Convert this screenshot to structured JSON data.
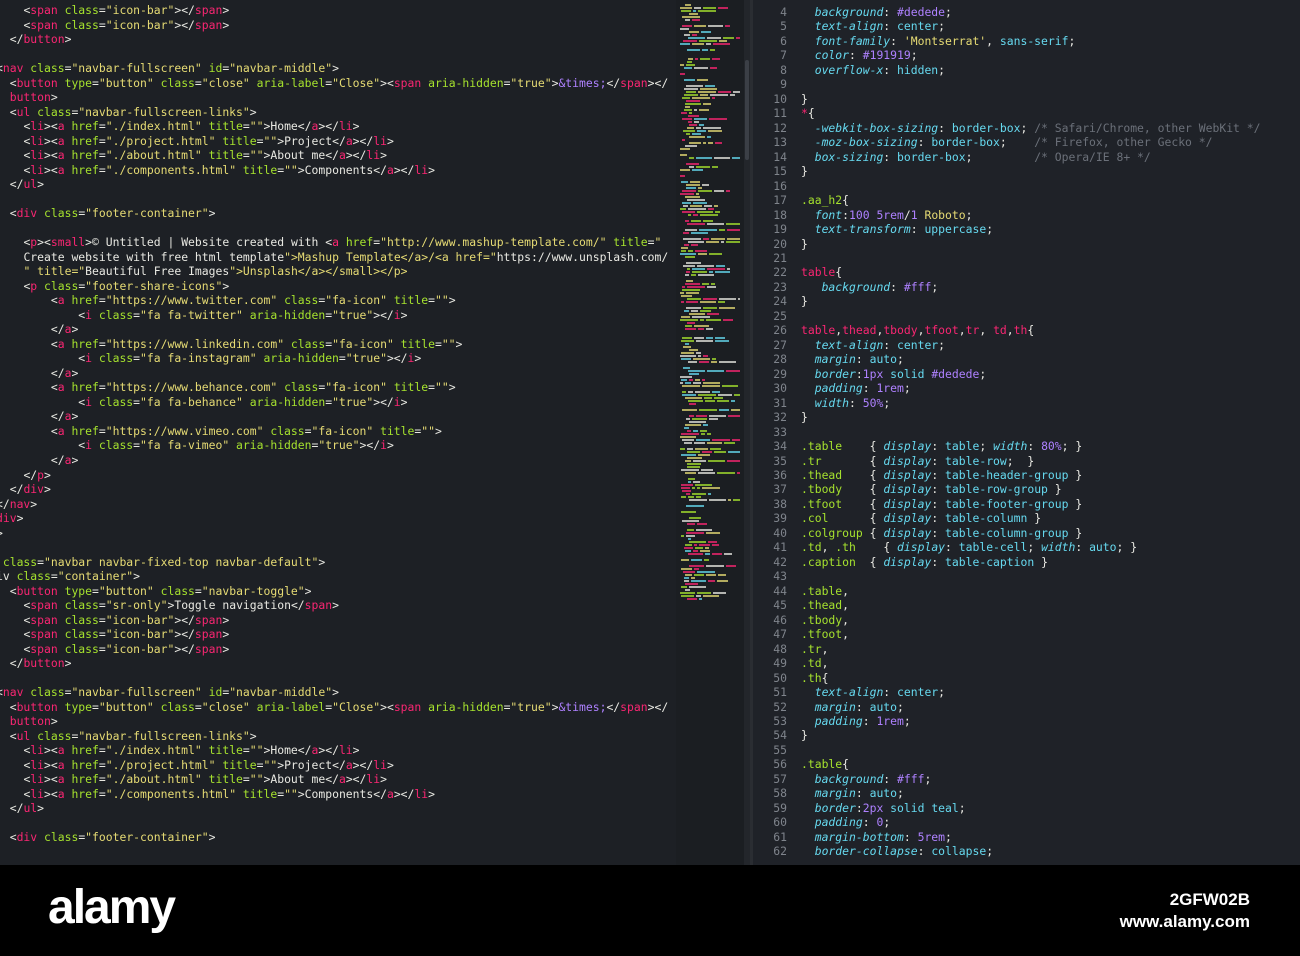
{
  "left_pane": {
    "language": "html",
    "lines": [
      "    <span class=\"icon-bar\"></span>",
      "    <span class=\"icon-bar\"></span>",
      "  </button>",
      "",
      "<nav class=\"navbar-fullscreen\" id=\"navbar-middle\">",
      "  <button type=\"button\" class=\"close\" aria-label=\"Close\"><span aria-hidden=\"true\">&times;</span></",
      "  button>",
      "  <ul class=\"navbar-fullscreen-links\">",
      "    <li><a href=\"./index.html\" title=\"\">Home</a></li>",
      "    <li><a href=\"./project.html\" title=\"\">Project</a></li>",
      "    <li><a href=\"./about.html\" title=\"\">About me</a></li>",
      "    <li><a href=\"./components.html\" title=\"\">Components</a></li>",
      "  </ul>",
      "",
      "  <div class=\"footer-container\">",
      "",
      "    <p><small>© Untitled | Website created with <a href=\"http://www.mashup-template.com/\" title=\"",
      "    Create website with free html template\">Mashup Template</a>/<a href=\"https://www.unsplash.com/",
      "    \" title=\"Beautiful Free Images\">Unsplash</a></small></p>",
      "    <p class=\"footer-share-icons\">",
      "        <a href=\"https://www.twitter.com\" class=\"fa-icon\" title=\"\">",
      "            <i class=\"fa fa-twitter\" aria-hidden=\"true\"></i>",
      "        </a>",
      "        <a href=\"https://www.linkedin.com\" class=\"fa-icon\" title=\"\">",
      "            <i class=\"fa fa-instagram\" aria-hidden=\"true\"></i>",
      "        </a>",
      "        <a href=\"https://www.behance.com\" class=\"fa-icon\" title=\"\">",
      "            <i class=\"fa fa-behance\" aria-hidden=\"true\"></i>",
      "        </a>",
      "        <a href=\"https://www.vimeo.com\" class=\"fa-icon\" title=\"\">",
      "            <i class=\"fa fa-vimeo\" aria-hidden=\"true\"></i>",
      "        </a>",
      "    </p>",
      "  </div>",
      "</nav>",
      "div>",
      ">",
      "",
      " class=\"navbar navbar-fixed-top navbar-default\">",
      "iv class=\"container\">",
      "  <button type=\"button\" class=\"navbar-toggle\">",
      "    <span class=\"sr-only\">Toggle navigation</span>",
      "    <span class=\"icon-bar\"></span>",
      "    <span class=\"icon-bar\"></span>",
      "    <span class=\"icon-bar\"></span>",
      "  </button>",
      "",
      "<nav class=\"navbar-fullscreen\" id=\"navbar-middle\">",
      "  <button type=\"button\" class=\"close\" aria-label=\"Close\"><span aria-hidden=\"true\">&times;</span></",
      "  button>",
      "  <ul class=\"navbar-fullscreen-links\">",
      "    <li><a href=\"./index.html\" title=\"\">Home</a></li>",
      "    <li><a href=\"./project.html\" title=\"\">Project</a></li>",
      "    <li><a href=\"./about.html\" title=\"\">About me</a></li>",
      "    <li><a href=\"./components.html\" title=\"\">Components</a></li>",
      "  </ul>",
      "",
      "  <div class=\"footer-container\">"
    ]
  },
  "right_pane": {
    "language": "css",
    "first_line_number": 4,
    "lines": [
      "  background: #dedede;",
      "  text-align: center;",
      "  font-family: 'Montserrat', sans-serif;",
      "  color: #191919;",
      "  overflow-x: hidden;",
      "",
      "}",
      "*{",
      "  -webkit-box-sizing: border-box; /* Safari/Chrome, other WebKit */",
      "  -moz-box-sizing: border-box;    /* Firefox, other Gecko */",
      "  box-sizing: border-box;         /* Opera/IE 8+ */",
      "}",
      "",
      ".aa_h2{",
      "  font:100 5rem/1 Roboto;",
      "  text-transform: uppercase;",
      "}",
      "",
      "table{",
      "   background: #fff;",
      "}",
      "",
      "table,thead,tbody,tfoot,tr, td,th{",
      "  text-align: center;",
      "  margin: auto;",
      "  border:1px solid #dedede;",
      "  padding: 1rem;",
      "  width: 50%;",
      "}",
      "",
      ".table    { display: table; width: 80%; }",
      ".tr       { display: table-row;  }",
      ".thead    { display: table-header-group }",
      ".tbody    { display: table-row-group }",
      ".tfoot    { display: table-footer-group }",
      ".col      { display: table-column }",
      ".colgroup { display: table-column-group }",
      ".td, .th    { display: table-cell; width: auto; }",
      ".caption  { display: table-caption }",
      "",
      ".table,",
      ".thead,",
      ".tbody,",
      ".tfoot,",
      ".tr,",
      ".td,",
      ".th{",
      "  text-align: center;",
      "  margin: auto;",
      "  padding: 1rem;",
      "}",
      "",
      ".table{",
      "  background: #fff;",
      "  margin: auto;",
      "  border:2px solid teal;",
      "  padding: 0;",
      "  margin-bottom: 5rem;",
      "  border-collapse: collapse;"
    ]
  },
  "watermark": {
    "logo": "alamy",
    "image_id": "2GFW02B",
    "site": "www.alamy.com"
  },
  "colors": {
    "background": "#1d2025",
    "tag": "#f92672",
    "attribute": "#a6e22e",
    "string": "#e6db74",
    "keyword": "#66d9ef",
    "number": "#ae81ff",
    "comment": "#6b7079"
  }
}
